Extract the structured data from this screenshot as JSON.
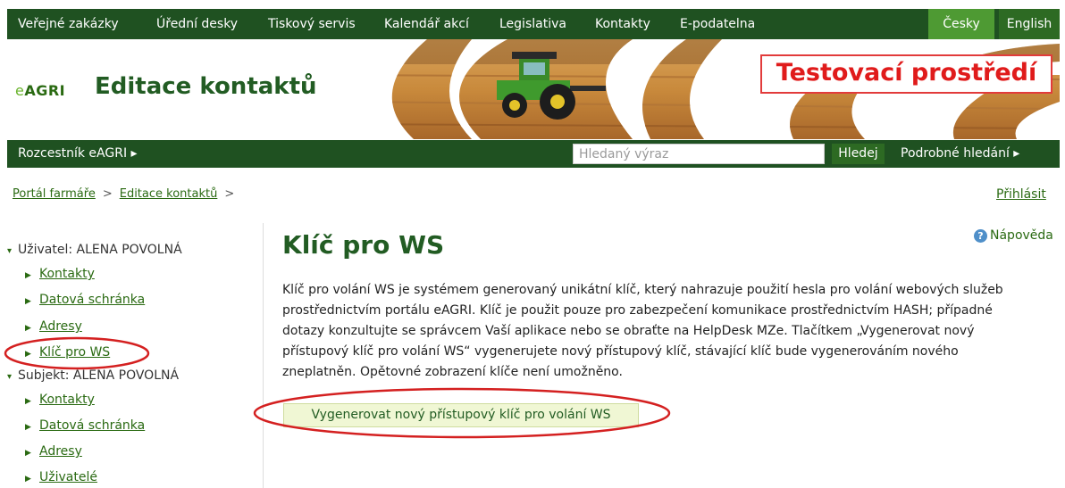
{
  "topnav": {
    "items": [
      "Veřejné zakázky",
      "Úřední desky",
      "Tiskový servis",
      "Kalendář akcí",
      "Legislativa",
      "Kontakty",
      "E-podatelna"
    ],
    "lang_cz": "Česky",
    "lang_en": "English"
  },
  "banner": {
    "logo": "AGRI",
    "logo_prefix": "e",
    "title": "Editace kontaktů",
    "test_label": "Testovací prostředí"
  },
  "subbar": {
    "rozcestnik": "Rozcestník eAGRI",
    "search_placeholder": "Hledaný výraz",
    "search_button": "Hledej",
    "advanced": "Podrobné hledání"
  },
  "breadcrumb": {
    "items": [
      "Portál farmáře",
      "Editace kontaktů"
    ],
    "separator": ">",
    "login": "Přihlásit"
  },
  "sidebar": {
    "user_header": "Uživatel: ALENA POVOLNÁ",
    "user_items": [
      "Kontakty",
      "Datová schránka",
      "Adresy",
      "Klíč pro WS"
    ],
    "subject_header": "Subjekt: ALENA POVOLNÁ",
    "subject_items": [
      "Kontakty",
      "Datová schránka",
      "Adresy",
      "Uživatelé"
    ]
  },
  "main": {
    "help": "Nápověda",
    "title": "Klíč pro WS",
    "description": "Klíč pro volání WS je systémem generovaný unikátní klíč, který nahrazuje použití hesla pro volání webových služeb prostřednictvím portálu eAGRI. Klíč je použit pouze pro zabezpečení komunikace prostřednictvím HASH; případné dotazy konzultujte se správcem Vaší aplikace nebo se obraťte na HelpDesk MZe. Tlačítkem „Vygenerovat nový přístupový klíč pro volání WS“ vygenerujete nový přístupový klíč, stávající klíč bude vygenerováním nového zneplatněn. Opětovné zobrazení klíče není umožněno.",
    "generate_button": "Vygenerovat nový přístupový klíč pro volání WS"
  },
  "colors": {
    "nav_green": "#1f5121",
    "accent_green": "#4e9a33",
    "text_green": "#225c23",
    "test_red": "#e01b1b",
    "annotation_red": "#d42020"
  }
}
